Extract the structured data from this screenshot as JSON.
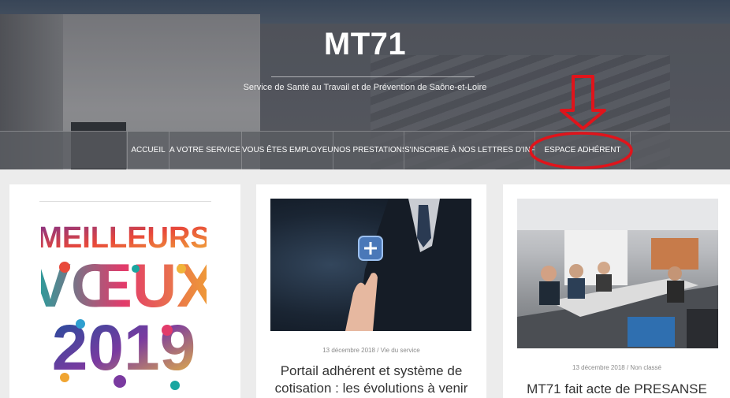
{
  "site": {
    "title": "MT71",
    "tagline": "Service de Santé au Travail et de Prévention de Saône-et-Loire"
  },
  "nav": {
    "items": [
      {
        "label": "Accueil"
      },
      {
        "label": "A votre service !"
      },
      {
        "label": "Vous êtes employeur..."
      },
      {
        "label": "Nos prestations"
      },
      {
        "label": "S'inscrire à nos lettres d'information"
      },
      {
        "label": "Espace adhérent"
      }
    ]
  },
  "annotation": {
    "color": "#e0141b",
    "target": "Espace adhérent"
  },
  "posts": [
    {
      "image_text": [
        "MEILLEURS",
        "VŒUX",
        "2019"
      ]
    },
    {
      "date": "13 décembre 2018",
      "separator": "/",
      "category": "Vie du service",
      "title": "Portail adhérent et système de cotisation : les évolutions à venir",
      "image_icon": "plus-icon"
    },
    {
      "date": "13 décembre 2018",
      "separator": "/",
      "category": "Non classé",
      "title": "MT71 fait acte de PRESANSE"
    }
  ]
}
